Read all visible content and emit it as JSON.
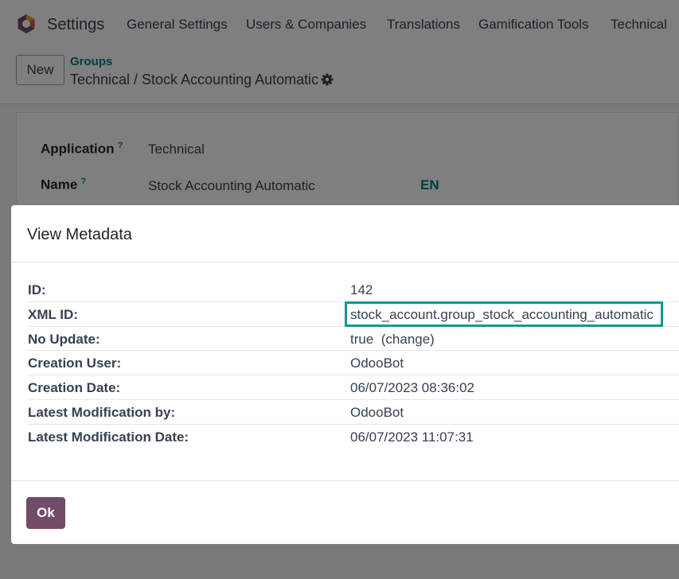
{
  "topbar": {
    "app_name": "Settings",
    "menu": [
      "General Settings",
      "Users & Companies",
      "Translations",
      "Gamification Tools",
      "Technical"
    ]
  },
  "control_panel": {
    "new_label": "New",
    "breadcrumb_parent": "Groups",
    "record_title": "Technical / Stock Accounting Automatic"
  },
  "form": {
    "application_label": "Application",
    "application_value": "Technical",
    "name_label": "Name",
    "name_value": "Stock Accounting Automatic",
    "lang_code": "EN",
    "help_marker": "?"
  },
  "dialog": {
    "title": "View Metadata",
    "rows": [
      {
        "key": "ID:",
        "value": "142"
      },
      {
        "key": "XML ID:",
        "value": "stock_account.group_stock_accounting_automatic"
      },
      {
        "key": "No Update:",
        "value": "true",
        "action": "(change)"
      },
      {
        "key": "Creation User:",
        "value": "OdooBot"
      },
      {
        "key": "Creation Date:",
        "value": "06/07/2023 08:36:02"
      },
      {
        "key": "Latest Modification by:",
        "value": "OdooBot"
      },
      {
        "key": "Latest Modification Date:",
        "value": "06/07/2023 11:07:31"
      }
    ],
    "ok_label": "Ok"
  },
  "colors": {
    "brand": "#714b67",
    "accent": "#017e84",
    "highlight": "#129891"
  },
  "icons": [
    "odoo-logo-icon",
    "gear-icon"
  ]
}
